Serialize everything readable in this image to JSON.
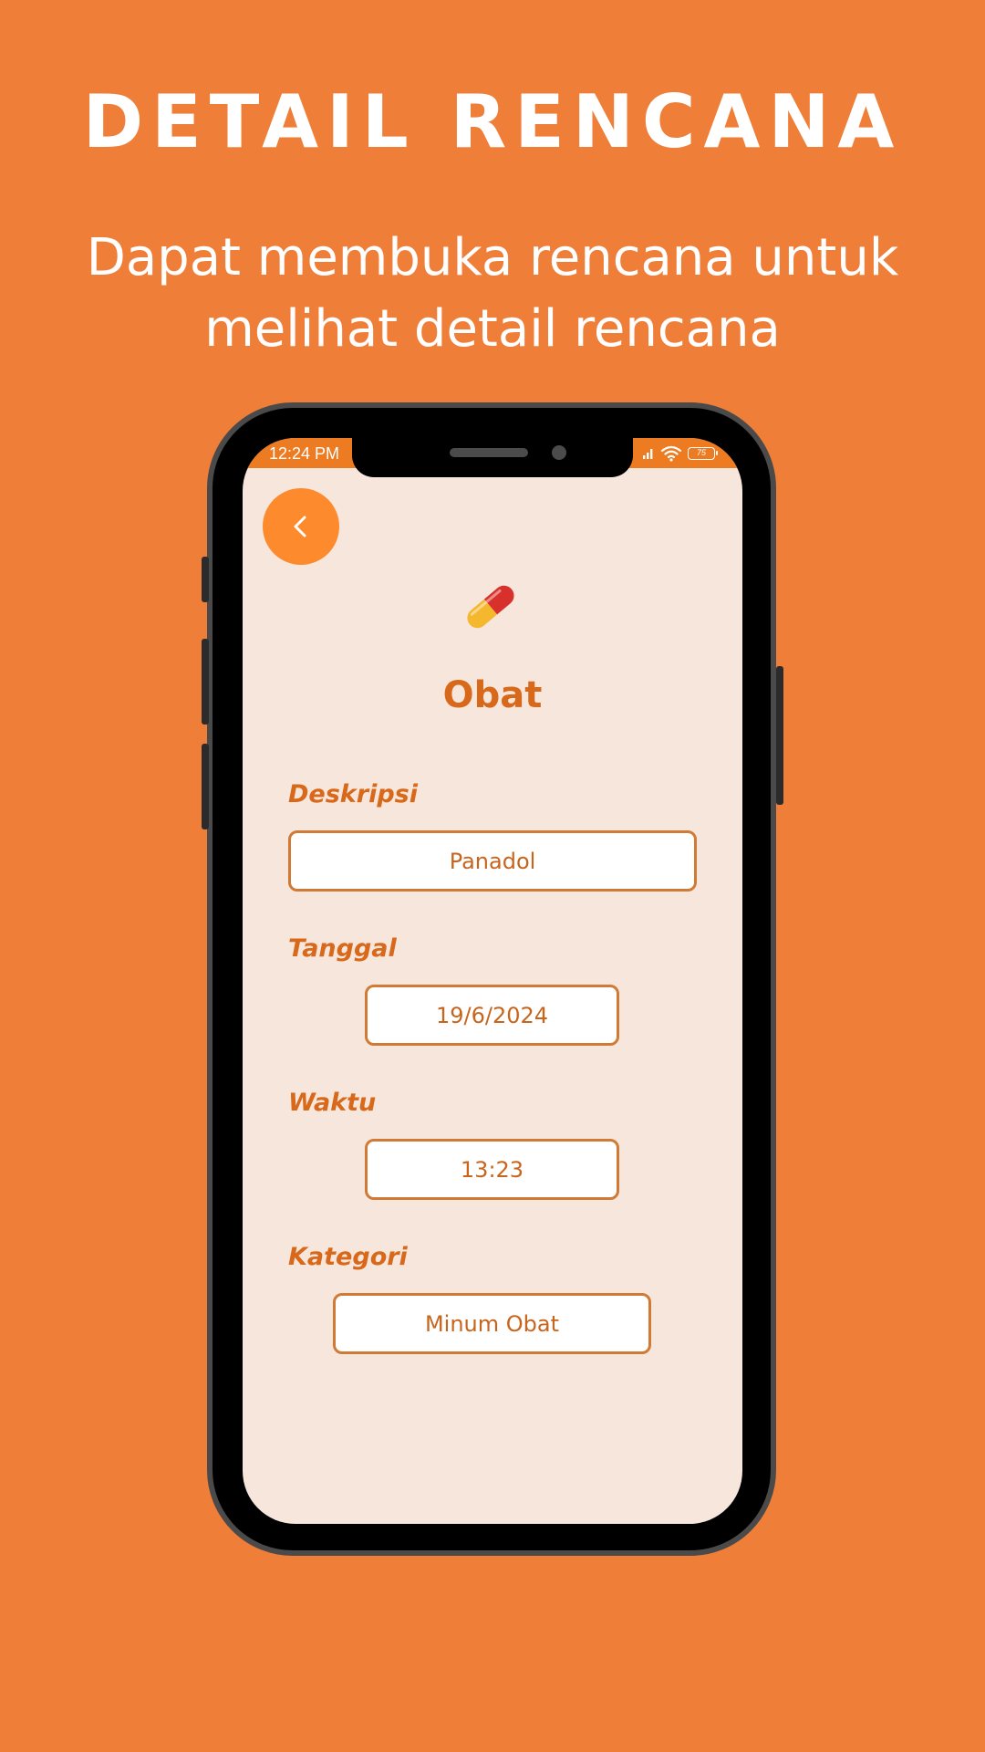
{
  "promo": {
    "title": "DETAIL RENCANA",
    "subtitle": "Dapat membuka rencana untuk melihat detail rencana"
  },
  "status_bar": {
    "time": "12:24 PM",
    "battery": "75"
  },
  "header": {
    "back_icon": "chevron-left-icon",
    "category_icon": "pill-icon",
    "title": "Obat"
  },
  "fields": {
    "description": {
      "label": "Deskripsi",
      "value": "Panadol"
    },
    "date": {
      "label": "Tanggal",
      "value": "19/6/2024"
    },
    "time": {
      "label": "Waktu",
      "value": "13:23"
    },
    "category": {
      "label": "Kategori",
      "value": "Minum Obat"
    }
  },
  "colors": {
    "background": "#EF7E38",
    "screen": "#F7E6DC",
    "accent": "#D8681A",
    "back_button": "#FD8A2C"
  }
}
